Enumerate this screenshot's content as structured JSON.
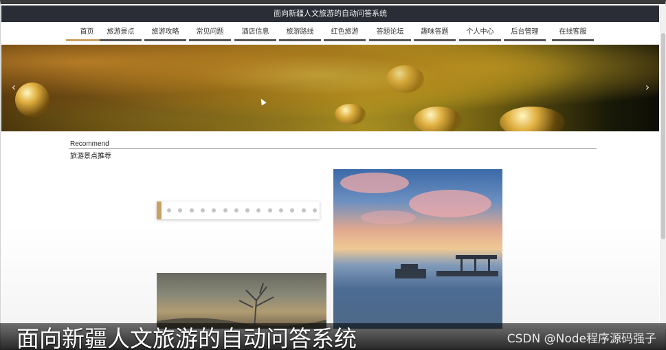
{
  "header": {
    "title": "面向新疆人文旅游的自动问答系统"
  },
  "nav": {
    "items": [
      {
        "label": "首页",
        "active": true
      },
      {
        "label": "旅游景点",
        "active": false
      },
      {
        "label": "旅游攻略",
        "active": false
      },
      {
        "label": "常见问题",
        "active": false
      },
      {
        "label": "酒店信息",
        "active": false
      },
      {
        "label": "旅游路线",
        "active": false
      },
      {
        "label": "红色旅游",
        "active": false
      },
      {
        "label": "答题论坛",
        "active": false
      },
      {
        "label": "趣味答题",
        "active": false
      },
      {
        "label": "个人中心",
        "active": false
      },
      {
        "label": "后台管理",
        "active": false
      },
      {
        "label": "在线客服",
        "active": false
      }
    ]
  },
  "banner": {
    "prev_icon": "chevron-left-icon",
    "next_icon": "chevron-right-icon",
    "prev_glyph": "‹",
    "next_glyph": "›"
  },
  "recommend": {
    "title_en": "Recommend",
    "title_cn": "旅游景点推荐"
  },
  "pager": {
    "dot_count": 14,
    "accent": "#c9a063"
  },
  "caption": {
    "text": "面向新疆人文旅游的自动问答系统"
  },
  "watermark": {
    "text": "CSDN @Node程序源码强子"
  },
  "colors": {
    "accent": "#c9a063",
    "header_bg": "#2a2d35"
  }
}
